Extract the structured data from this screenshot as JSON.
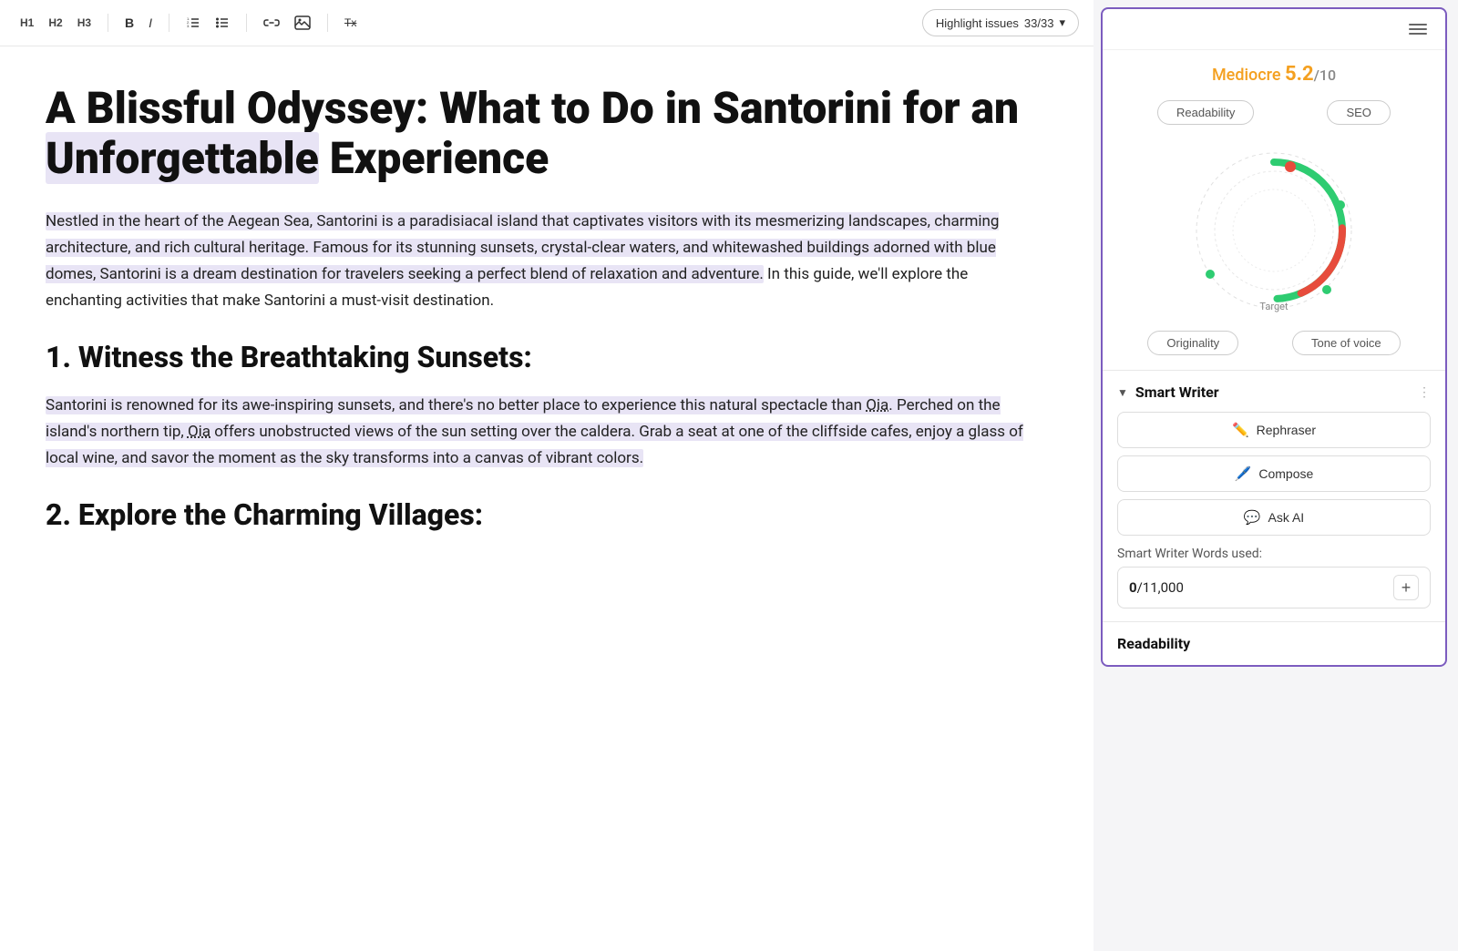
{
  "toolbar": {
    "h1_label": "H1",
    "h2_label": "H2",
    "h3_label": "H3",
    "bold_label": "B",
    "italic_label": "I",
    "bullet_icon": "≡",
    "list_icon": "≡",
    "link_icon": "🔗",
    "image_icon": "🖼",
    "clear_label": "Tx",
    "highlight_label": "Highlight issues",
    "highlight_count": "33/33",
    "chevron": "▾"
  },
  "editor": {
    "title_part1": "A Blissful Odyssey: What to Do in Santorini for an ",
    "title_highlight": "Unforgettable",
    "title_part2": " Experience",
    "para1_part1": "Nestled in the heart of the Aegean Sea, Santorini is a paradisiacal island that captivates visitors with its mesmerizing landscapes, charming architecture, and rich cultural heritage. Famous for its stunning sunsets, crystal-clear waters, and whitewashed buildings adorned with blue domes, Santorini is a dream destination for travelers seeking a perfect blend of relaxation and adventure. In this guide, we'll explore the enchanting activities that make Santorini a must-visit destination.",
    "h2_1": "1. Witness the Breathtaking Sunsets:",
    "para2_part1": "Santorini is renowned for its awe-inspiring sunsets, and there's no better place to experience this natural spectacle than ",
    "para2_oia": "Oia",
    "para2_part2": ". Perched on the island's northern tip, ",
    "para2_oia2": "Oia",
    "para2_part3": " offers unobstructed views of the sun setting over the caldera. Grab a seat at one of the cliffside cafes, enjoy a glass of local wine, and savor the moment as the sky transforms into a canvas of vibrant colors.",
    "h2_2": "2. Explore the Charming Villages:"
  },
  "sidebar": {
    "menu_icon": "☰",
    "score_label": "Mediocre",
    "score_value": "5.2",
    "score_denom": "/10",
    "tab_readability": "Readability",
    "tab_seo": "SEO",
    "tab_originality": "Originality",
    "tab_tone": "Tone of voice",
    "gauge_target": "Target",
    "smart_writer_title": "Smart Writer",
    "rephraser_label": "Rephraser",
    "compose_label": "Compose",
    "ask_ai_label": "Ask AI",
    "words_used_label": "Smart Writer Words used:",
    "words_count": "0",
    "words_limit": "/11,000",
    "add_label": "+",
    "readability_label": "Readability"
  }
}
